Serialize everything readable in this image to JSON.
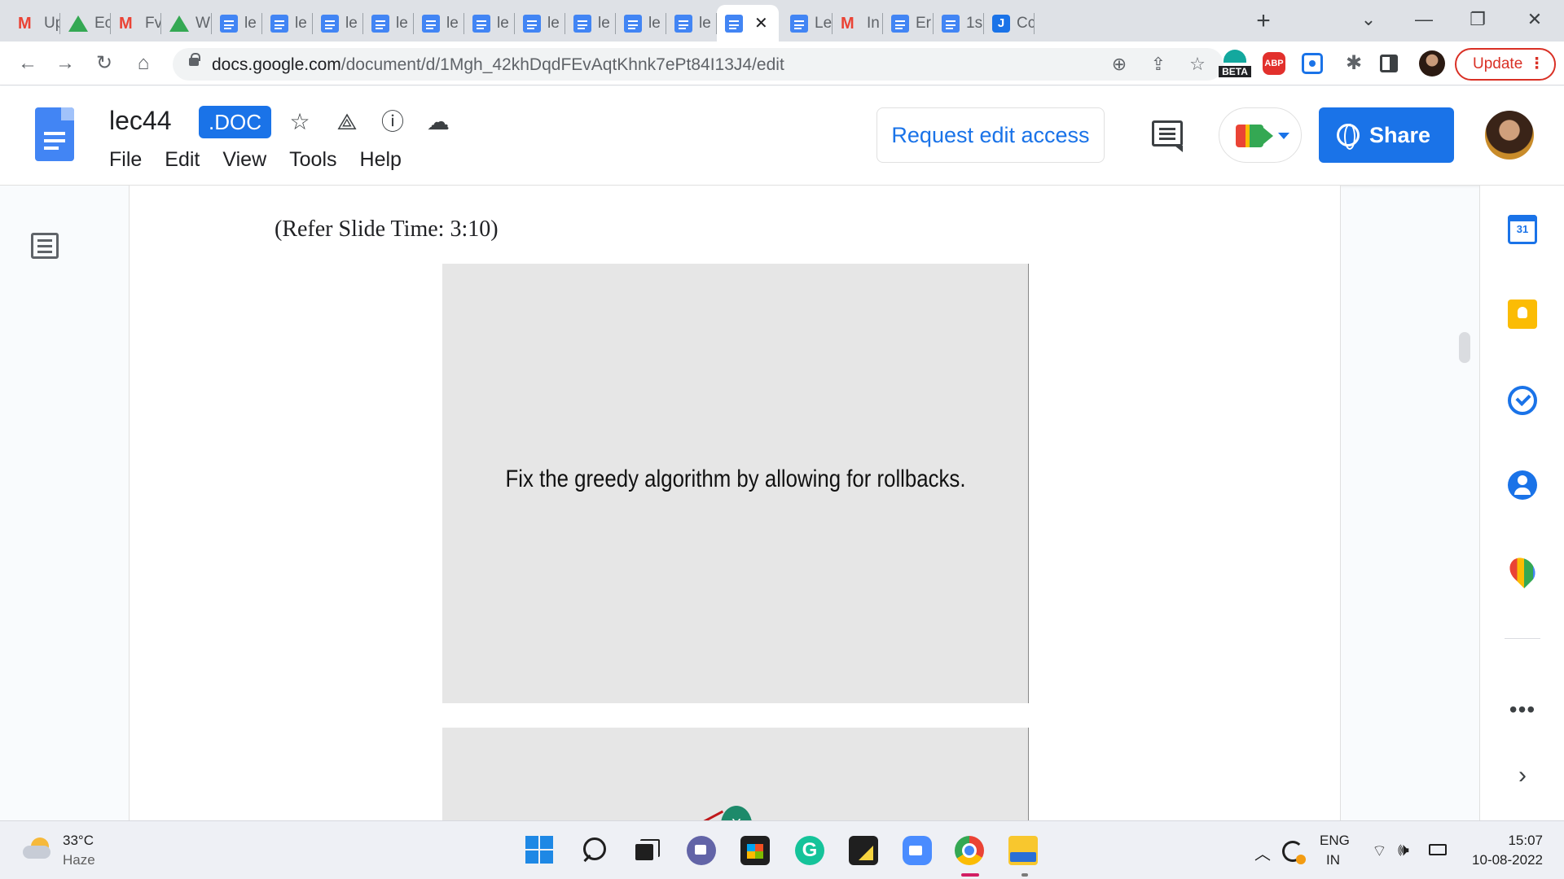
{
  "browser": {
    "tabs": [
      {
        "favicon": "gmail",
        "label": "Up"
      },
      {
        "favicon": "drive",
        "label": "Ec"
      },
      {
        "favicon": "gmail",
        "label": "Fv"
      },
      {
        "favicon": "drive",
        "label": "W"
      },
      {
        "favicon": "docs",
        "label": "le"
      },
      {
        "favicon": "docs",
        "label": "le"
      },
      {
        "favicon": "docs",
        "label": "le"
      },
      {
        "favicon": "docs",
        "label": "le"
      },
      {
        "favicon": "docs",
        "label": "le"
      },
      {
        "favicon": "docs",
        "label": "le"
      },
      {
        "favicon": "docs",
        "label": "le"
      },
      {
        "favicon": "docs",
        "label": "le"
      },
      {
        "favicon": "docs",
        "label": "le"
      },
      {
        "favicon": "docs",
        "label": "le"
      },
      {
        "favicon": "docs",
        "label": "",
        "active": true,
        "close_glyph": "✕"
      },
      {
        "favicon": "docs",
        "label": "Le"
      },
      {
        "favicon": "gmail",
        "label": "In"
      },
      {
        "favicon": "docs",
        "label": "Er"
      },
      {
        "favicon": "docs",
        "label": "1s"
      },
      {
        "favicon": "jamboard",
        "label": "Cc"
      }
    ],
    "new_tab_glyph": "+",
    "window_controls": {
      "tab_search": "⌄",
      "minimize": "—",
      "restore": "❐",
      "close": "✕"
    },
    "nav": {
      "back": "←",
      "forward": "→",
      "reload": "↻",
      "home": "⌂"
    },
    "url_host": "docs.google.com",
    "url_path": "/document/d/1Mgh_42khDqdFEvAqtKhnk7ePt84I13J4/edit",
    "omnibox_icons": {
      "zoom": "⊕",
      "share": "⇪",
      "bookmark": "☆"
    },
    "extensions": {
      "beta_label": "BETA",
      "abp_label": "ABP",
      "puzzle": "✱"
    },
    "update_label": "Update",
    "update_menu": "⋮"
  },
  "docs": {
    "title": "lec44",
    "badge": ".DOC",
    "header_icons": {
      "star": "☆",
      "move": "⟁",
      "info": "ⓘ",
      "cloud": "☁"
    },
    "menu": [
      "File",
      "Edit",
      "View",
      "Tools",
      "Help"
    ],
    "request_edit_label": "Request edit access",
    "share_label": "Share"
  },
  "content": {
    "slide_reference": "(Refer Slide Time: 3:10)",
    "slide1_text": "Fix the greedy algorithm by allowing for rollbacks.",
    "slide2_node_label": "X"
  },
  "side_panel": {
    "calendar_day": "31",
    "more": "•••",
    "expand": "›"
  },
  "taskbar": {
    "temperature": "33°C",
    "condition": "Haze",
    "grammarly_glyph": "G",
    "tray_up": "︿",
    "wifi": "⌔",
    "volume": "🕪",
    "lang_line1": "ENG",
    "lang_line2": "IN",
    "time": "15:07",
    "date": "10-08-2022"
  },
  "colors": {
    "accent": "#1a73e8",
    "update_red": "#d93025",
    "node_green": "#1d8a6a"
  }
}
